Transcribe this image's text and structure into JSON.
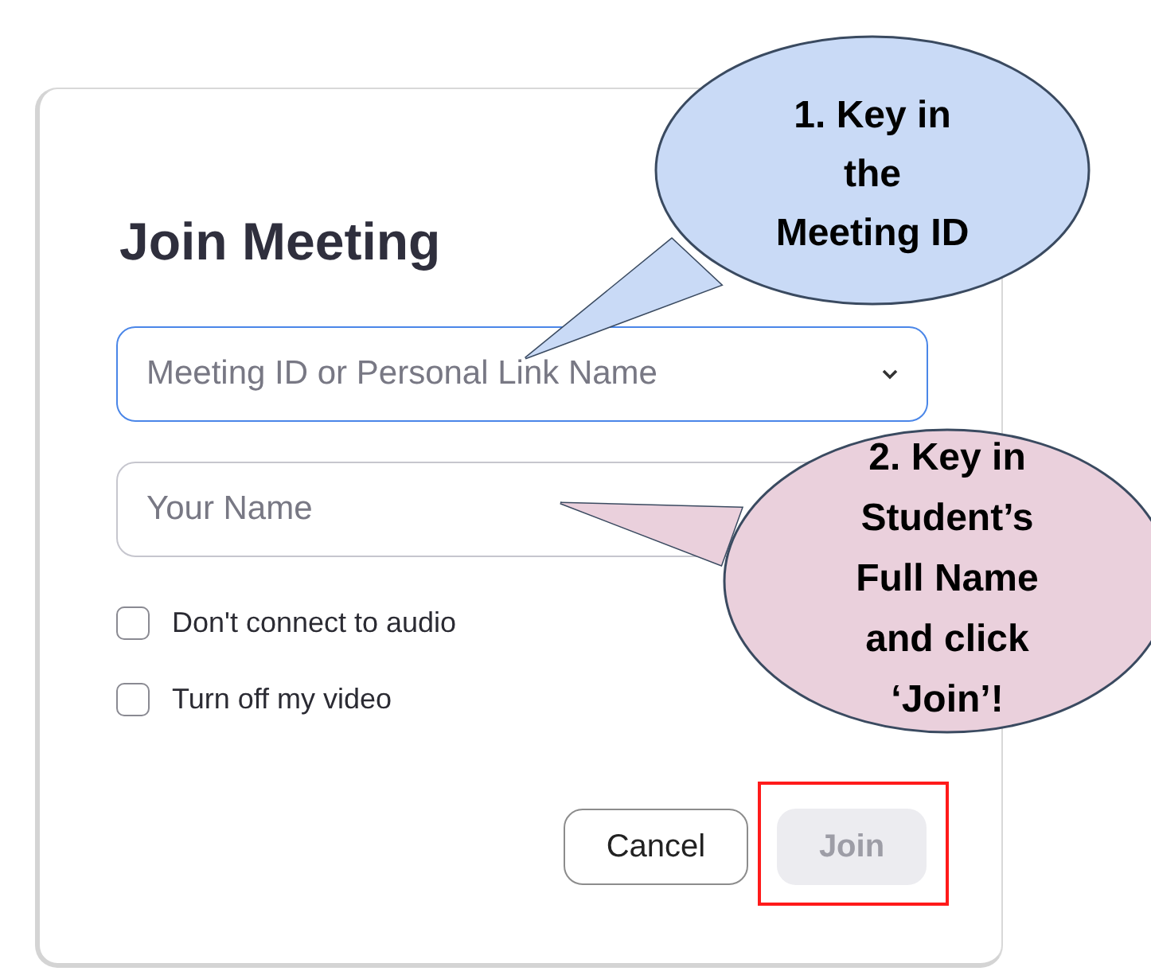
{
  "dialog": {
    "title": "Join Meeting",
    "fields": [
      {
        "placeholder": "Meeting ID or Personal Link Name",
        "focused": true,
        "kind": "dropdown"
      },
      {
        "placeholder": "Your Name",
        "focused": false,
        "kind": "text"
      }
    ],
    "options": [
      {
        "label": "Don't connect to audio",
        "checked": false
      },
      {
        "label": "Turn off my video",
        "checked": false
      }
    ],
    "buttons": [
      {
        "label": "Cancel",
        "disabled": false,
        "highlighted": false
      },
      {
        "label": "Join",
        "disabled": true,
        "highlighted": true
      }
    ]
  },
  "callouts": [
    {
      "text": "1. Key in\nthe\nMeeting ID",
      "color": "#c9daf6"
    },
    {
      "text": "2. Key in\nStudent’s\nFull Name\nand click\n‘Join’!",
      "color": "#ead0dc"
    }
  ]
}
